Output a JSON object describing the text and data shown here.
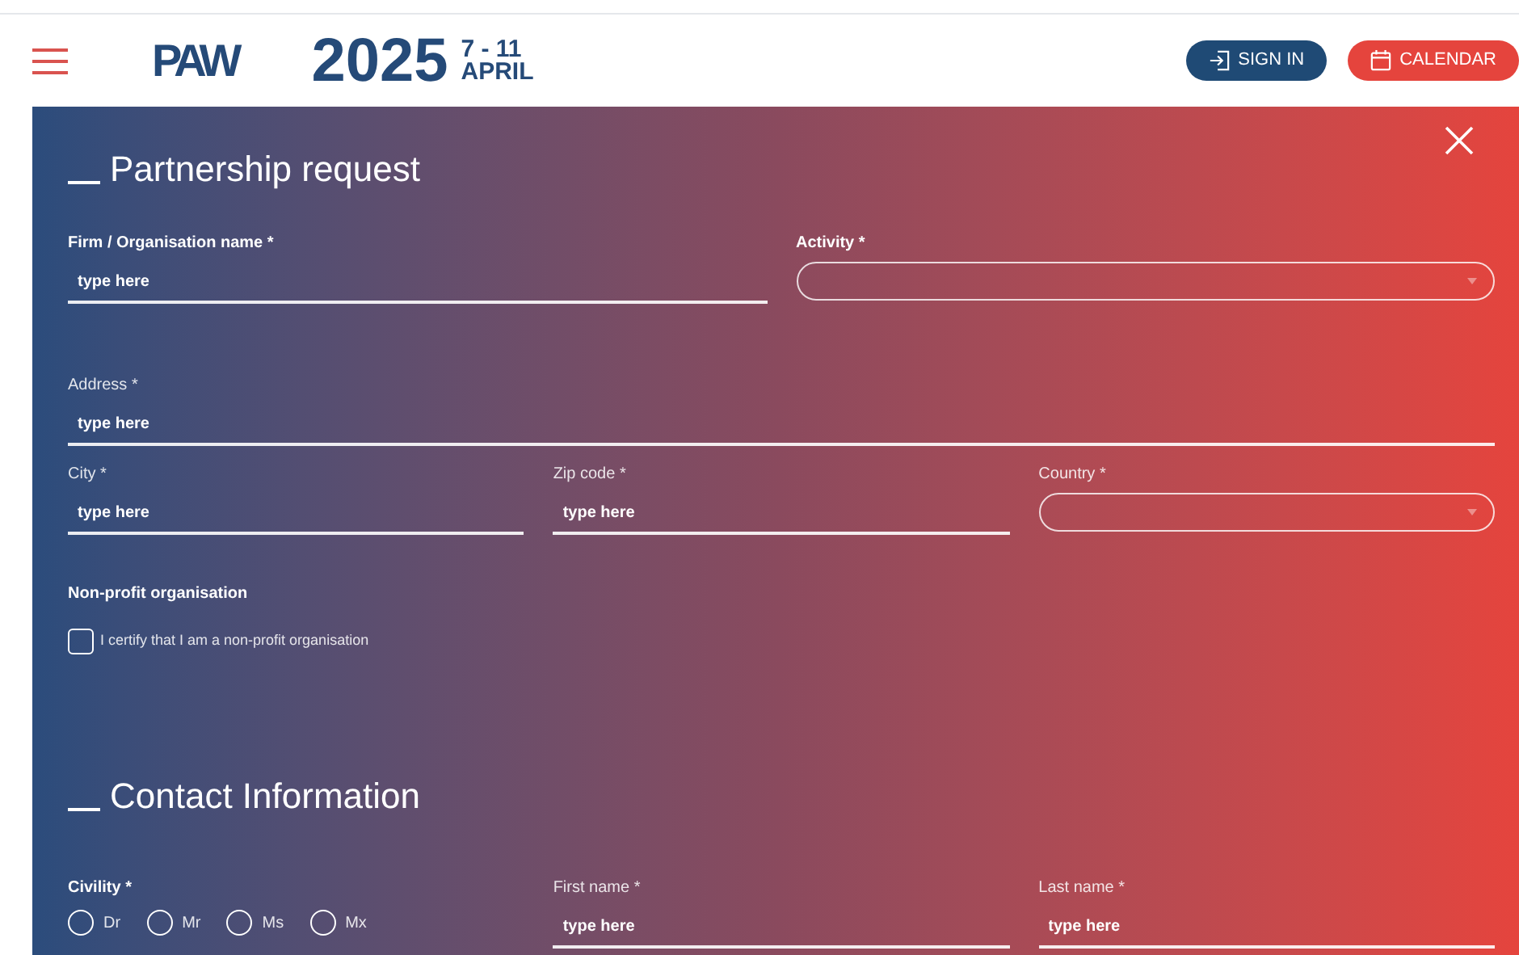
{
  "header": {
    "logo": "PAW",
    "year": "2025",
    "dates": "7 - 11",
    "month": "APRIL",
    "buttons": [
      {
        "label": "SIGN IN",
        "kind": "signin"
      },
      {
        "label": "CALENDAR",
        "kind": "calendar"
      }
    ]
  },
  "sections": [
    {
      "title": "Partnership request",
      "rows": [
        [
          {
            "kind": "text",
            "label": "Firm / Organisation name *",
            "bold": true,
            "placeholder": "type here"
          },
          {
            "kind": "select",
            "label": "Activity *",
            "bold": true
          }
        ],
        [
          {
            "kind": "text",
            "label": "Address *",
            "bold": false,
            "placeholder": "type here"
          }
        ],
        [
          {
            "kind": "text",
            "label": "City *",
            "bold": false,
            "placeholder": "type here"
          },
          {
            "kind": "text",
            "label": "Zip code *",
            "bold": false,
            "placeholder": "type here"
          },
          {
            "kind": "select",
            "label": "Country *",
            "bold": false
          }
        ],
        [
          {
            "kind": "checkbox",
            "label": "Non-profit organisation",
            "bold": true,
            "option": "I certify that I am a non-profit organisation",
            "checked": false
          }
        ]
      ]
    },
    {
      "title": "Contact Information",
      "rows": [
        [
          {
            "kind": "radio",
            "label": "Civility *",
            "bold": true,
            "options": [
              {
                "label": "Dr",
                "selected": false
              },
              {
                "label": "Mr",
                "selected": false
              },
              {
                "label": "Ms",
                "selected": false
              },
              {
                "label": "Mx",
                "selected": false
              }
            ]
          },
          {
            "kind": "text",
            "label": "First name *",
            "bold": false,
            "placeholder": "type here"
          },
          {
            "kind": "text",
            "label": "Last name *",
            "bold": false,
            "placeholder": "type here"
          }
        ]
      ]
    }
  ]
}
